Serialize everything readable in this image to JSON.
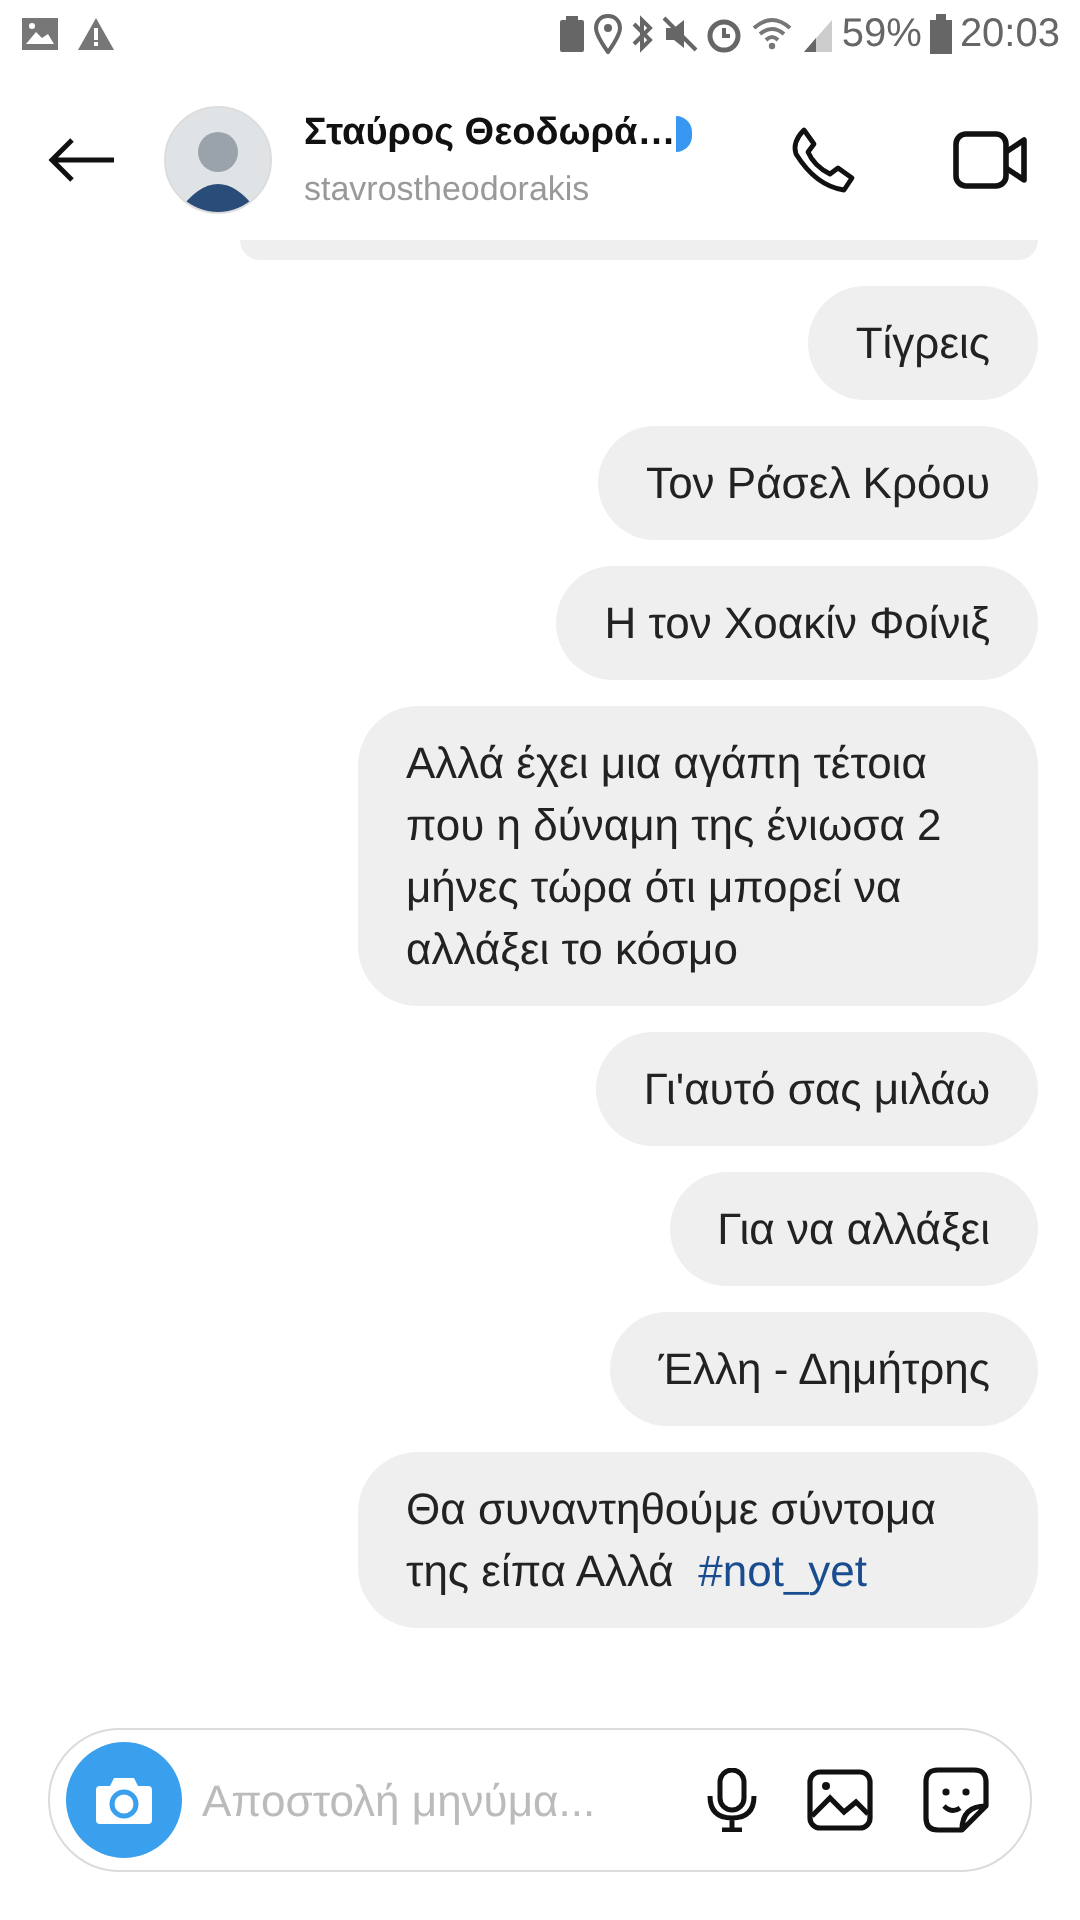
{
  "status_bar": {
    "battery": "59%",
    "time": "20:03"
  },
  "header": {
    "name": "Σταύρος Θεοδωρά…",
    "username": "stavrostheodorakis",
    "verified": true
  },
  "messages": [
    {
      "text": "Τίγρεις"
    },
    {
      "text": "Τον Ράσελ Κρόου"
    },
    {
      "text": "Η τον Χοακίν Φοίνιξ"
    },
    {
      "text": "Αλλά έχει μια αγάπη τέτοια που η δύναμη της ένιωσα 2 μήνες τώρα ότι μπορεί να αλλάξει το κόσμο"
    },
    {
      "text": "Γι'αυτό σας μιλάω"
    },
    {
      "text": "Για να αλλάξει"
    },
    {
      "text": "Έλλη - Δημήτρης"
    },
    {
      "text": "Θα συναντηθούμε σύντομα της είπα Αλλά",
      "hashtag": "#not_yet"
    }
  ],
  "composer": {
    "placeholder": "Αποστολή μηνύμα..."
  }
}
